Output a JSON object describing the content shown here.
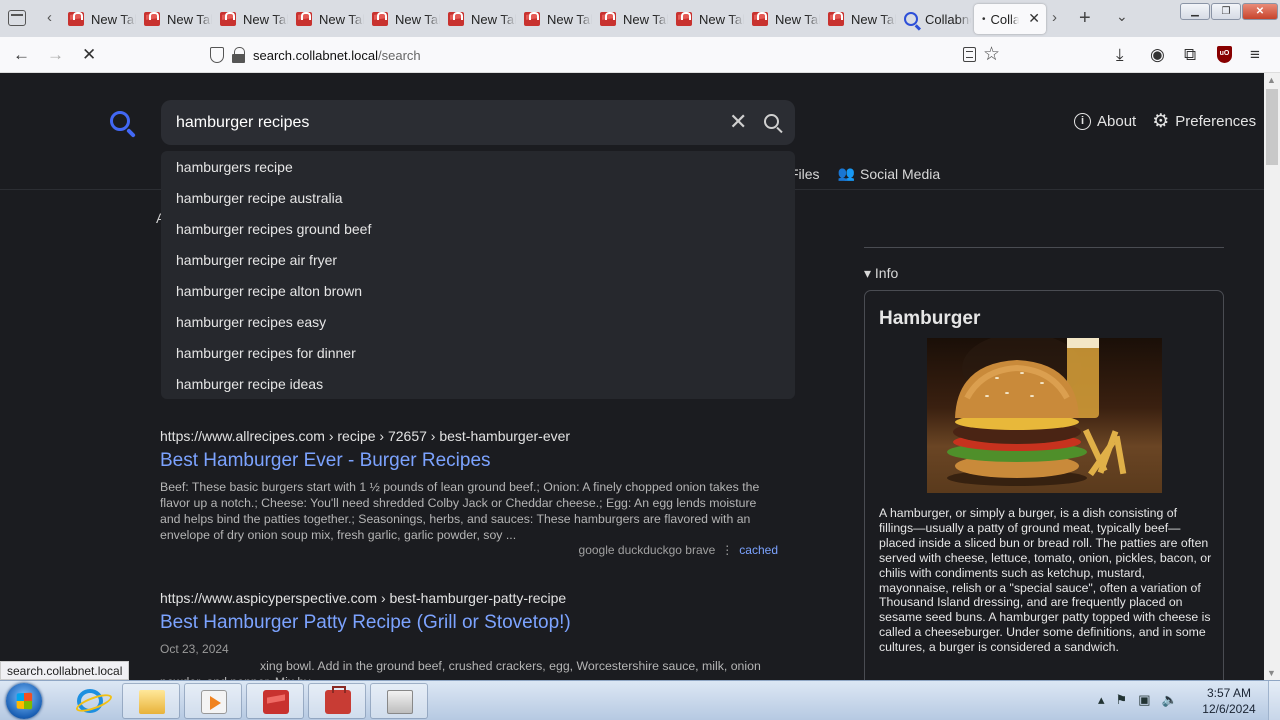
{
  "browser": {
    "tabs": [
      {
        "title": "New Tab",
        "icon": "gift-icon"
      },
      {
        "title": "New Tab",
        "icon": "gift-icon"
      },
      {
        "title": "New Tab",
        "icon": "gift-icon"
      },
      {
        "title": "New Tab",
        "icon": "gift-icon"
      },
      {
        "title": "New Tab",
        "icon": "gift-icon"
      },
      {
        "title": "New Tab",
        "icon": "gift-icon"
      },
      {
        "title": "New Tab",
        "icon": "gift-icon"
      },
      {
        "title": "New Tab",
        "icon": "gift-icon"
      },
      {
        "title": "New Tab",
        "icon": "gift-icon"
      },
      {
        "title": "New Tab",
        "icon": "gift-icon"
      },
      {
        "title": "New Tab",
        "icon": "gift-icon"
      },
      {
        "title": "Collabnet",
        "icon": "search-icon"
      },
      {
        "title": "Collabnet",
        "icon": "loading-dot",
        "active": true
      }
    ],
    "url_host": "search.collabnet.local",
    "url_path": "/search",
    "status_url": "search.collabnet.local"
  },
  "search": {
    "query": "hamburger recipes",
    "suggestions": [
      "hamburgers recipe",
      "hamburger recipe australia",
      "hamburger recipes ground beef",
      "hamburger recipe air fryer",
      "hamburger recipe alton brown",
      "hamburger recipes easy",
      "hamburger recipes for dinner",
      "hamburger recipe ideas"
    ]
  },
  "header_links": {
    "about": "About",
    "preferences": "Preferences"
  },
  "categories": {
    "files": "Files",
    "social_media": "Social Media"
  },
  "partial_letter": "A",
  "results": [
    {
      "url": "https://www.allrecipes.com  › recipe › 72657 › best-hamburger-ever",
      "title": "Best Hamburger Ever - Burger Recipes",
      "snippet": "Beef: These basic burgers start with 1 ½ pounds of lean ground beef.; Onion: A finely chopped onion takes the flavor up a notch.; Cheese: You'll need shredded Colby Jack or Cheddar cheese.; Egg: An egg lends moisture and helps bind the patties together.; Seasonings, herbs, and sauces: These hamburgers are flavored with an envelope of dry onion soup mix, fresh garlic, garlic powder, soy ...",
      "engines": "google  duckduckgo  brave",
      "cached": "cached"
    },
    {
      "url": "https://www.aspicyperspective.com  › best-hamburger-patty-recipe",
      "title": "Best Hamburger Patty Recipe (Grill or Stovetop!)",
      "date": "Oct 23, 2024",
      "snippet": "xing bowl. Add in the ground beef, crushed crackers, egg, Worcestershire sauce, milk, onion powder, and pepper. Mix by ..."
    }
  ],
  "infobox": {
    "toggle": "Info",
    "title": "Hamburger",
    "text": "A hamburger, or simply a burger, is a dish consisting of fillings—usually a patty of ground meat, typically beef—placed inside a sliced bun or bread roll. The patties are often served with cheese, lettuce, tomato, onion, pickles, bacon, or chilis with condiments such as ketchup, mustard, mayonnaise, relish or a \"special sauce\", often a variation of Thousand Island dressing, and are frequently placed on sesame seed buns. A hamburger patty topped with cheese is called a cheeseburger. Under some definitions, and in some cultures, a burger is considered a sandwich."
  },
  "taskbar": {
    "time": "3:57 AM",
    "date": "12/6/2024"
  },
  "colors": {
    "page_bg": "#1b1c20",
    "link": "#7ca3ff",
    "accent": "#4268f5"
  }
}
